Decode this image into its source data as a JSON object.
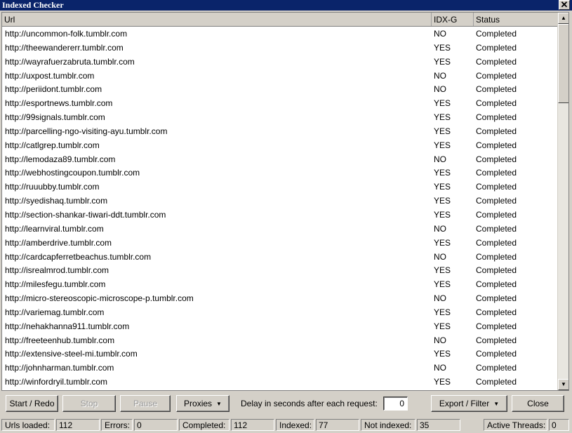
{
  "window": {
    "title": "Indexed Checker",
    "close_glyph": "✕"
  },
  "grid": {
    "columns": [
      "Url",
      "IDX-G",
      "Status"
    ],
    "rows": [
      [
        "http://uncommon-folk.tumblr.com",
        "NO",
        "Completed"
      ],
      [
        "http://theewandererr.tumblr.com",
        "YES",
        "Completed"
      ],
      [
        "http://wayrafuerzabruta.tumblr.com",
        "YES",
        "Completed"
      ],
      [
        "http://uxpost.tumblr.com",
        "NO",
        "Completed"
      ],
      [
        "http://periidont.tumblr.com",
        "NO",
        "Completed"
      ],
      [
        "http://esportnews.tumblr.com",
        "YES",
        "Completed"
      ],
      [
        "http://99signals.tumblr.com",
        "YES",
        "Completed"
      ],
      [
        "http://parcelling-ngo-visiting-ayu.tumblr.com",
        "YES",
        "Completed"
      ],
      [
        "http://catlgrep.tumblr.com",
        "YES",
        "Completed"
      ],
      [
        "http://lemodaza89.tumblr.com",
        "NO",
        "Completed"
      ],
      [
        "http://webhostingcoupon.tumblr.com",
        "YES",
        "Completed"
      ],
      [
        "http://ruuubby.tumblr.com",
        "YES",
        "Completed"
      ],
      [
        "http://syedishaq.tumblr.com",
        "YES",
        "Completed"
      ],
      [
        "http://section-shankar-tiwari-ddt.tumblr.com",
        "YES",
        "Completed"
      ],
      [
        "http://learnviral.tumblr.com",
        "NO",
        "Completed"
      ],
      [
        "http://amberdrive.tumblr.com",
        "YES",
        "Completed"
      ],
      [
        "http://cardcapferretbeachus.tumblr.com",
        "NO",
        "Completed"
      ],
      [
        "http://isrealmrod.tumblr.com",
        "YES",
        "Completed"
      ],
      [
        "http://milesfegu.tumblr.com",
        "YES",
        "Completed"
      ],
      [
        "http://micro-stereoscopic-microscope-p.tumblr.com",
        "NO",
        "Completed"
      ],
      [
        "http://variemag.tumblr.com",
        "YES",
        "Completed"
      ],
      [
        "http://nehakhanna911.tumblr.com",
        "YES",
        "Completed"
      ],
      [
        "http://freeteenhub.tumblr.com",
        "NO",
        "Completed"
      ],
      [
        "http://extensive-steel-mi.tumblr.com",
        "YES",
        "Completed"
      ],
      [
        "http://johnharman.tumblr.com",
        "NO",
        "Completed"
      ],
      [
        "http://winfordryil.tumblr.com",
        "YES",
        "Completed"
      ]
    ]
  },
  "toolbar": {
    "start": "Start / Redo",
    "stop": "Stop",
    "pause": "Pause",
    "proxies": "Proxies",
    "delay_label": "Delay in seconds after each request:",
    "delay_value": "0",
    "export": "Export / Filter",
    "close": "Close",
    "dropdown_glyph": "▼"
  },
  "status": {
    "urls_loaded_label": "Urls loaded:",
    "urls_loaded": "112",
    "errors_label": "Errors:",
    "errors": "0",
    "completed_label": "Completed:",
    "completed": "112",
    "indexed_label": "Indexed:",
    "indexed": "77",
    "not_indexed_label": "Not indexed:",
    "not_indexed": "35",
    "threads_label": "Active Threads:",
    "threads": "0"
  },
  "icons": {
    "scroll_up": "▲",
    "scroll_down": "▼"
  },
  "colors": {
    "titlebar": "#0a246a",
    "face": "#d4d0c8"
  }
}
